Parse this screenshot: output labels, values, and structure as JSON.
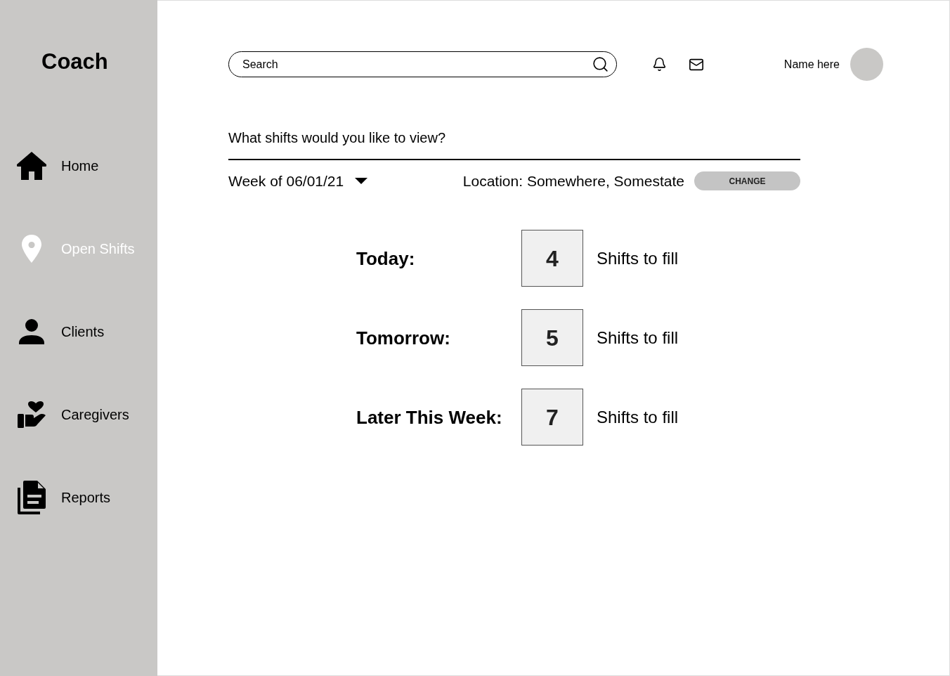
{
  "sidebar": {
    "title": "Coach",
    "items": [
      {
        "label": "Home",
        "selected": false
      },
      {
        "label": "Open Shifts",
        "selected": true
      },
      {
        "label": "Clients",
        "selected": false
      },
      {
        "label": "Caregivers",
        "selected": false
      },
      {
        "label": "Reports",
        "selected": false
      }
    ]
  },
  "header": {
    "search": {
      "placeholder": "Search"
    },
    "user_name": "Name here"
  },
  "filter": {
    "prompt": "What shifts would you like to view?",
    "week": "Week of 06/01/21",
    "location": "Location: Somewhere, Somestate",
    "change_button": "CHANGE"
  },
  "stats": [
    {
      "label": "Today:",
      "count": "4",
      "caption": "Shifts to fill"
    },
    {
      "label": "Tomorrow:",
      "count": "5",
      "caption": "Shifts to fill"
    },
    {
      "label": "Later This Week:",
      "count": "7",
      "caption": "Shifts to fill"
    }
  ]
}
